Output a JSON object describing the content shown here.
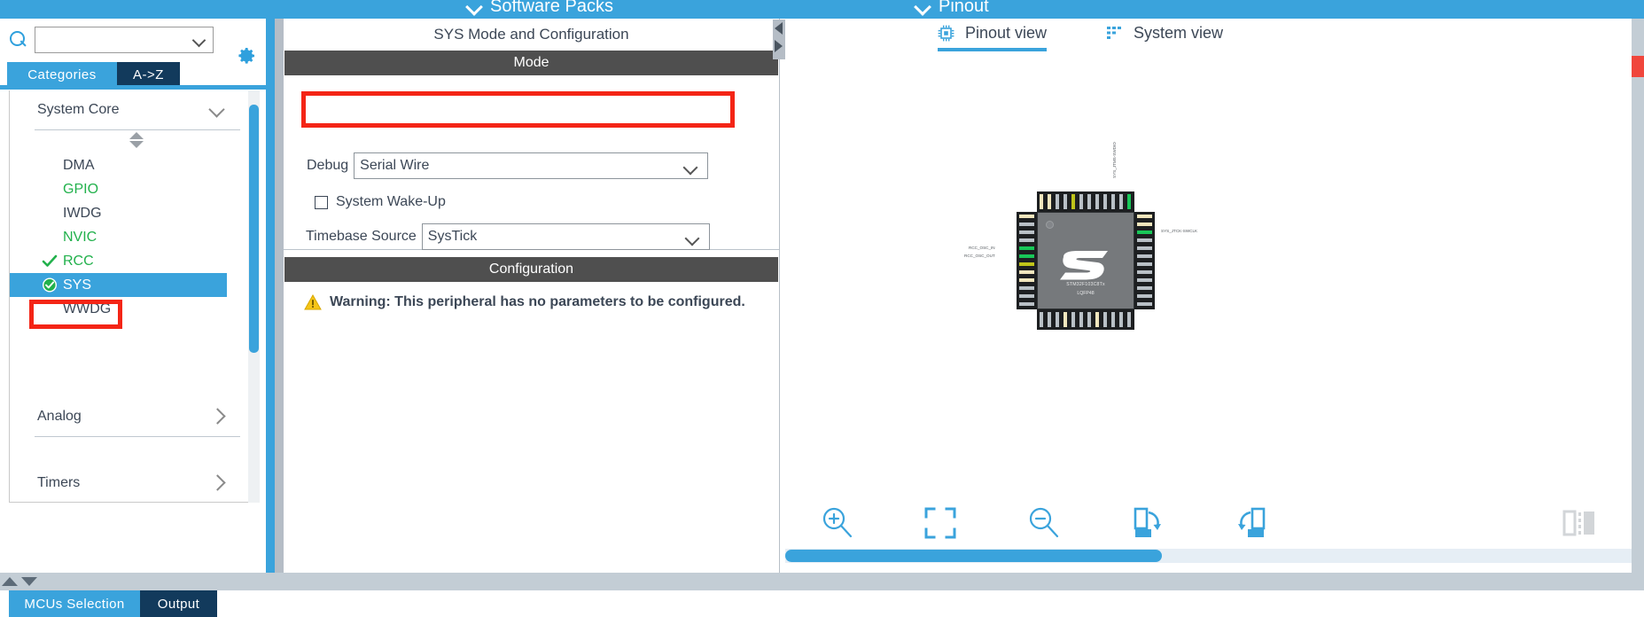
{
  "topbar": {
    "menus": [
      {
        "label": "Software Packs",
        "icon": "chevron-down-icon"
      },
      {
        "label": "Pinout",
        "icon": "chevron-down-icon"
      }
    ]
  },
  "sidebar": {
    "search": {
      "value": "",
      "placeholder": "",
      "icon": "search-icon"
    },
    "gear_icon": "gear-icon",
    "tabs": [
      {
        "label": "Categories",
        "active": true
      },
      {
        "label": "A->Z",
        "active": false
      }
    ],
    "groups": [
      {
        "label": "System Core",
        "expanded": true
      },
      {
        "label": "Analog",
        "expanded": false
      },
      {
        "label": "Timers",
        "expanded": false
      }
    ],
    "peripherals": [
      {
        "label": "DMA",
        "state": "default",
        "checked": false
      },
      {
        "label": "GPIO",
        "state": "green",
        "checked": false
      },
      {
        "label": "IWDG",
        "state": "default",
        "checked": false
      },
      {
        "label": "NVIC",
        "state": "green",
        "checked": false
      },
      {
        "label": "RCC",
        "state": "green",
        "checked": true
      },
      {
        "label": "SYS",
        "state": "selected",
        "checked": true
      },
      {
        "label": "WWDG",
        "state": "default",
        "checked": false
      }
    ]
  },
  "center": {
    "title": "SYS Mode and Configuration",
    "mode_header": "Mode",
    "debug": {
      "label": "Debug",
      "value": "Serial Wire"
    },
    "wakeup": {
      "label": "System Wake-Up",
      "checked": false
    },
    "timebase": {
      "label": "Timebase Source",
      "value": "SysTick"
    },
    "configuration_header": "Configuration",
    "warning": {
      "icon": "warning-triangle-icon",
      "text": "Warning: This peripheral has no parameters to be configured."
    }
  },
  "right": {
    "tabs": [
      {
        "label": "Pinout view",
        "icon": "chip-icon",
        "active": true
      },
      {
        "label": "System view",
        "icon": "grid-icon",
        "active": false
      }
    ],
    "chip": {
      "part_number": "STM32F103C8Tx",
      "package": "LQFP48",
      "logo": "st-logo",
      "net_labels": [
        "RCC_OSC_IN",
        "RCC_OSC_OUT",
        "SYS_JTMS-SWDIO",
        "SYS_JTCK-SWCLK"
      ]
    },
    "toolbar": [
      {
        "name": "zoom-in-icon",
        "label": "Zoom In"
      },
      {
        "name": "fit-to-screen-icon",
        "label": "Fit To Screen"
      },
      {
        "name": "zoom-out-icon",
        "label": "Zoom Out"
      },
      {
        "name": "rotate-right-icon",
        "label": "Rotate Right"
      },
      {
        "name": "rotate-left-icon",
        "label": "Rotate Left"
      },
      {
        "name": "split-panel-icon",
        "label": "Split Panel"
      }
    ]
  },
  "bottom_tabs": [
    {
      "label": "MCUs Selection",
      "active": true
    },
    {
      "label": "Output",
      "active": false
    }
  ],
  "colors": {
    "accent": "#3aa3dc",
    "dark_navy": "#123a5c",
    "section_header": "#4f4f4f",
    "green": "#22b14c",
    "annotation_red": "#f42516",
    "warning_yellow": "#f5c518"
  }
}
